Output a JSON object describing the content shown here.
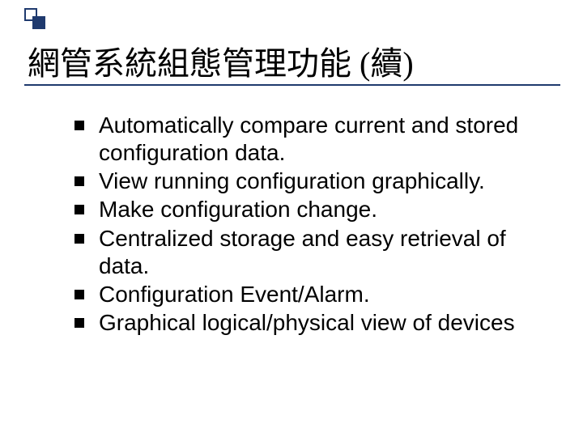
{
  "title": "網管系統組態管理功能 (續)",
  "bullets": [
    "Automatically compare current and stored configuration data.",
    "View running configuration graphically.",
    "Make configuration change.",
    "Centralized storage and easy retrieval of data.",
    "Configuration Event/Alarm.",
    "Graphical logical/physical view of devices"
  ]
}
